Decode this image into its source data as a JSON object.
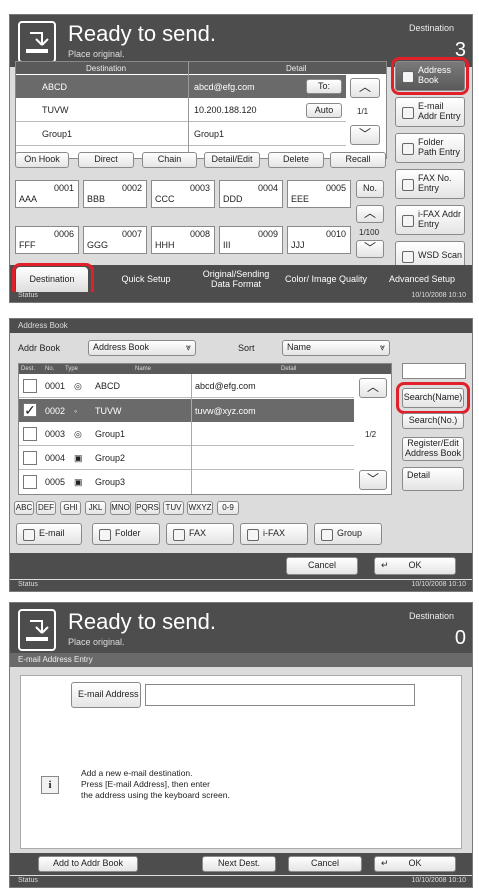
{
  "panel1": {
    "title": "Ready to send.",
    "subtitle": "Place original.",
    "dest_label": "Destination",
    "dest_count": "3",
    "col_destination": "Destination",
    "col_detail": "Detail",
    "rows": [
      {
        "dest": "ABCD",
        "detail": "abcd@efg.com",
        "tag": "To:"
      },
      {
        "dest": "TUVW",
        "detail": "10.200.188.120",
        "tag": "Auto"
      },
      {
        "dest": "Group1",
        "detail": "Group1",
        "tag": ""
      }
    ],
    "page": "1/1",
    "actions": [
      "On Hook",
      "Direct",
      "Chain",
      "Detail/Edit",
      "Delete",
      "Recall"
    ],
    "side_buttons": [
      "Address Book",
      "E-mail Addr Entry",
      "Folder Path Entry",
      "FAX No. Entry",
      "i-FAX Addr Entry",
      "WSD Scan"
    ],
    "grid": [
      {
        "num": "0001",
        "name": "AAA"
      },
      {
        "num": "0002",
        "name": "BBB"
      },
      {
        "num": "0003",
        "name": "CCC"
      },
      {
        "num": "0004",
        "name": "DDD"
      },
      {
        "num": "0005",
        "name": "EEE"
      },
      {
        "num": "0006",
        "name": "FFF"
      },
      {
        "num": "0007",
        "name": "GGG"
      },
      {
        "num": "0008",
        "name": "HHH"
      },
      {
        "num": "0009",
        "name": "III"
      },
      {
        "num": "0010",
        "name": "JJJ"
      }
    ],
    "no_label": "No.",
    "grid_page": "1/100",
    "tabs": [
      "Destination",
      "Quick Setup",
      "Original/Sending Data Format",
      "Color/ Image Quality",
      "Advanced Setup"
    ],
    "status": "Status",
    "datetime": "10/10/2008   10:10"
  },
  "panel2": {
    "title": "Address Book",
    "addr_book_label": "Addr Book",
    "addr_book_value": "Address Book",
    "sort_label": "Sort",
    "sort_value": "Name",
    "col_dest": "Dest.",
    "col_no": "No.",
    "col_type": "Type",
    "col_name": "Name",
    "col_detail": "Detail",
    "rows": [
      {
        "no": "0001",
        "name": "ABCD",
        "detail": "abcd@efg.com",
        "checked": false
      },
      {
        "no": "0002",
        "name": "TUVW",
        "detail": "tuvw@xyz.com",
        "checked": true
      },
      {
        "no": "0003",
        "name": "Group1",
        "detail": "",
        "checked": false
      },
      {
        "no": "0004",
        "name": "Group2",
        "detail": "",
        "checked": false
      },
      {
        "no": "0005",
        "name": "Group3",
        "detail": "",
        "checked": false
      }
    ],
    "page": "1/2",
    "side_buttons": [
      "Search(Name)",
      "Search(No.)",
      "Register/Edit Address Book",
      "Detail"
    ],
    "alpha": [
      "ABC",
      "DEF",
      "GHI",
      "JKL",
      "MNO",
      "PQRS",
      "TUV",
      "WXYZ",
      "0-9"
    ],
    "filters": [
      "E-mail",
      "Folder",
      "FAX",
      "i-FAX",
      "Group"
    ],
    "cancel": "Cancel",
    "ok": "OK",
    "status": "Status",
    "datetime": "10/10/2008   10:10"
  },
  "panel3": {
    "title": "Ready to send.",
    "subtitle": "Place original.",
    "dest_label": "Destination",
    "dest_count": "0",
    "section": "E-mail Address Entry",
    "email_label": "E-mail Address",
    "email_value": "",
    "info": "Add a new e-mail destination.\nPress [E-mail Address], then enter\nthe address using the keyboard screen.",
    "add_to_addr_book": "Add to Addr Book",
    "next_dest": "Next Dest.",
    "cancel": "Cancel",
    "ok": "OK",
    "status": "Status",
    "datetime": "10/10/2008   10:10"
  },
  "colors": {
    "header": "#4d4d4d",
    "highlight": "#e0202a",
    "selected_row": "#6a6a6a"
  }
}
